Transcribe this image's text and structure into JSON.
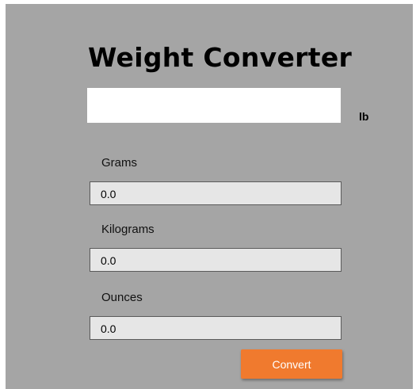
{
  "app": {
    "title": "Weight Converter"
  },
  "input": {
    "value": "",
    "placeholder": "",
    "unit": "lb"
  },
  "outputs": [
    {
      "label": "Grams",
      "value": "0.0"
    },
    {
      "label": "Kilograms",
      "value": "0.0"
    },
    {
      "label": "Ounces",
      "value": "0.0"
    }
  ],
  "convert_button": {
    "label": "Convert"
  },
  "colors": {
    "panel_background": "#a5a5a5",
    "output_background": "#e6e6e6",
    "button_accent": "#f07a2e"
  }
}
